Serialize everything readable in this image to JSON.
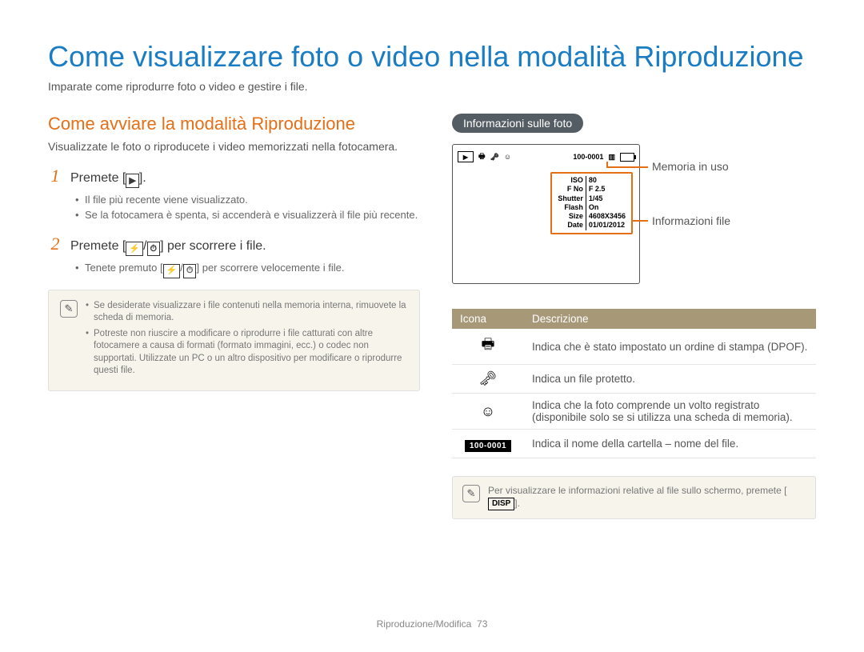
{
  "title": "Come visualizzare foto o video nella modalità Riproduzione",
  "intro": "Imparate come riprodurre foto o video e gestire i file.",
  "left": {
    "subheading": "Come avviare la modalità Riproduzione",
    "lead": "Visualizzate le foto o riproducete i video memorizzati nella fotocamera.",
    "step1_prefix": "Premete [",
    "step1_suffix": "].",
    "step1_icon": "▶",
    "step1_bullets": [
      "Il file più recente viene visualizzato.",
      "Se la fotocamera è spenta, si accenderà e visualizzerà il file più recente."
    ],
    "step2_prefix": "Premete [",
    "step2_mid": "/",
    "step2_suffix": "] per scorrere i file.",
    "step2_icon_a": "⚡",
    "step2_icon_b": "⏱",
    "step2_bullets_prefix": "Tenete premuto [",
    "step2_bullets_suffix": "] per scorrere velocemente i file.",
    "notes": [
      "Se desiderate visualizzare i file contenuti nella memoria interna, rimuovete la scheda di memoria.",
      "Potreste non riuscire a modificare o riprodurre i file catturati con altre fotocamere a causa di formati (formato immagini, ecc.) o codec non supportati. Utilizzate un PC o un altro dispositivo per modificare o riprodurre questi file."
    ]
  },
  "right": {
    "pill": "Informazioni sulle foto",
    "lcd": {
      "folder_file": "100-0001",
      "info_rows": [
        [
          "ISO",
          "80"
        ],
        [
          "F No",
          "F 2.5"
        ],
        [
          "Shutter",
          "1/45"
        ],
        [
          "Flash",
          "On"
        ],
        [
          "Size",
          "4608X3456"
        ],
        [
          "Date",
          "01/01/2012"
        ]
      ],
      "callout_memory": "Memoria in uso",
      "callout_info": "Informazioni file"
    },
    "table": {
      "head_icon": "Icona",
      "head_desc": "Descrizione",
      "rows": [
        {
          "icon_name": "print-icon",
          "glyph": "🖶",
          "desc": "Indica che è stato impostato un ordine di stampa (DPOF)."
        },
        {
          "icon_name": "protected-icon",
          "glyph": "🗝",
          "desc": "Indica un file protetto."
        },
        {
          "icon_name": "face-registered-icon",
          "glyph": "☺",
          "desc": "Indica che la foto comprende un volto registrato (disponibile solo se si utilizza una scheda di memoria)."
        },
        {
          "icon_name": "folder-file-chip",
          "glyph": "100-0001",
          "desc": "Indica il nome della cartella – nome del file."
        }
      ]
    },
    "note_prefix": "Per visualizzare le informazioni relative al file sullo schermo, premete [",
    "note_chip": "DISP",
    "note_suffix": "]."
  },
  "footer": {
    "section": "Riproduzione/Modifica",
    "page": "73"
  }
}
